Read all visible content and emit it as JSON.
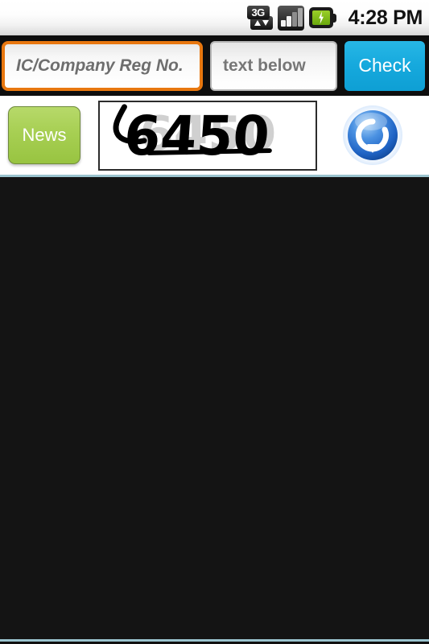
{
  "status_bar": {
    "time": "4:28 PM",
    "icons": [
      {
        "name": "3g-data-icon",
        "label": "3G"
      },
      {
        "name": "signal-bars-icon",
        "label": ""
      },
      {
        "name": "battery-charging-icon",
        "label": ""
      }
    ]
  },
  "toolbar": {
    "reg_no_field": {
      "value": "",
      "placeholder": "IC/Company Reg No.",
      "focused": true
    },
    "captcha_field": {
      "value": "",
      "placeholder": "text below",
      "focused": false
    },
    "check_label": "Check"
  },
  "captcha_row": {
    "news_label": "News",
    "captcha_code": "6450",
    "refresh_icon": "refresh-icon"
  },
  "colors": {
    "focus_border": "#e8770f",
    "check_button": "#16a9dd",
    "news_button": "#a7cf53",
    "refresh_blue": "#2f7fd6",
    "content_background": "#141414",
    "divider": "#9bc4cf",
    "battery_green": "#8ac41a"
  }
}
